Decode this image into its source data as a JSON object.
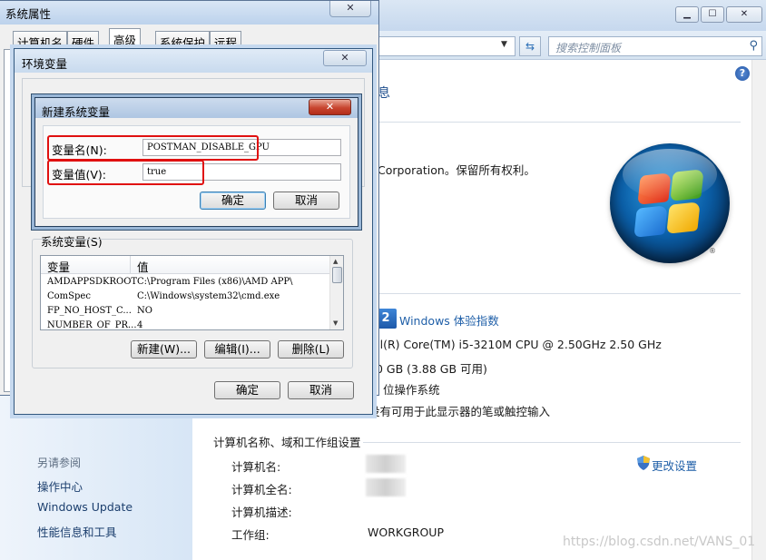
{
  "control_panel": {
    "search_placeholder": "搜索控制面板",
    "heading_fragment": "息",
    "copyright_fragment": "Corporation。保留所有权利。",
    "wei_badge": "2",
    "wei_link": "Windows 体验指数",
    "cpu_fragment": "tel(R) Core(TM) i5-3210M CPU @ 2.50GHz   2.50 GHz",
    "memory_fragment": "00 GB (3.88 GB 可用)",
    "os_bits_fragment": "位操作系统",
    "pen_fragment": "没有可用于此显示器的笔或触控输入",
    "section_title": "计算机名称、域和工作组设置",
    "fields": [
      {
        "label": "计算机名:",
        "value": ""
      },
      {
        "label": "计算机全名:",
        "value": ""
      },
      {
        "label": "计算机描述:",
        "value": ""
      },
      {
        "label": "工作组:",
        "value": "WORKGROUP"
      }
    ],
    "change_settings": "更改设置",
    "see_also": "另请参阅",
    "see_also_links": [
      "操作中心",
      "Windows Update",
      "性能信息和工具"
    ],
    "watermark": "https://blog.csdn.net/VANS_01"
  },
  "system_properties": {
    "title": "系统属性",
    "tabs": [
      "计算机名",
      "硬件",
      "高级",
      "系统保护",
      "远程"
    ],
    "active_tab": "高级",
    "close": "✕"
  },
  "env_vars": {
    "title": "环境变量",
    "close": "✕",
    "system_vars_label": "系统变量(S)",
    "columns": [
      "变量",
      "值"
    ],
    "rows": [
      {
        "name": "AMDAPPSDKROOT",
        "value": "C:\\Program Files (x86)\\AMD APP\\"
      },
      {
        "name": "ComSpec",
        "value": "C:\\Windows\\system32\\cmd.exe"
      },
      {
        "name": "FP_NO_HOST_C...",
        "value": "NO"
      },
      {
        "name": "NUMBER_OF_PR...",
        "value": "4"
      }
    ],
    "buttons": {
      "new": "新建(W)...",
      "edit": "编辑(I)...",
      "delete": "删除(L)",
      "ok": "确定",
      "cancel": "取消"
    }
  },
  "new_var_dialog": {
    "title": "新建系统变量",
    "close": "✕",
    "name_label": "变量名(N):",
    "name_value": "POSTMAN_DISABLE_GPU",
    "value_label": "变量值(V):",
    "value_value": "true",
    "ok": "确定",
    "cancel": "取消"
  },
  "colors": {
    "highlight_box": "#e01010",
    "link": "#1f5fa8",
    "title_bar": "#c8daee"
  },
  "icons": [
    "minimize-icon",
    "maximize-icon",
    "close-icon",
    "refresh-icon",
    "search-icon",
    "help-icon",
    "shield-icon",
    "windows-logo-icon"
  ]
}
